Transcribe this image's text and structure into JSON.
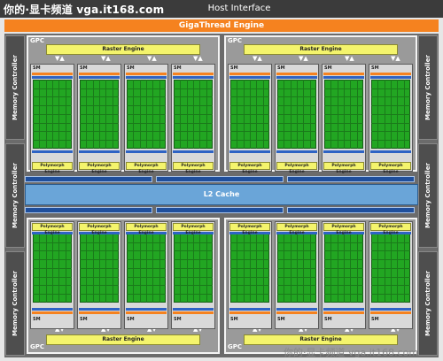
{
  "watermark_top": "你的·显卡频道 vga.it168.com",
  "host_interface": "Host Interface",
  "gigathread": "GigaThread Engine",
  "l2_cache": "L2 Cache",
  "memory_controller": "Memory Controller",
  "gpc_label": "GPC",
  "raster_engine": "Raster Engine",
  "polymorph_engine": "Polymorph Engine",
  "sm_label": "SM",
  "watermark_bottom": "你的·显卡频道 vga.it168.com",
  "colors": {
    "host": "#3b3b3b",
    "gigathread": "#f5821f",
    "l2": "#6aa5d8",
    "engine": "#f4f46c",
    "core": "#22a622"
  }
}
